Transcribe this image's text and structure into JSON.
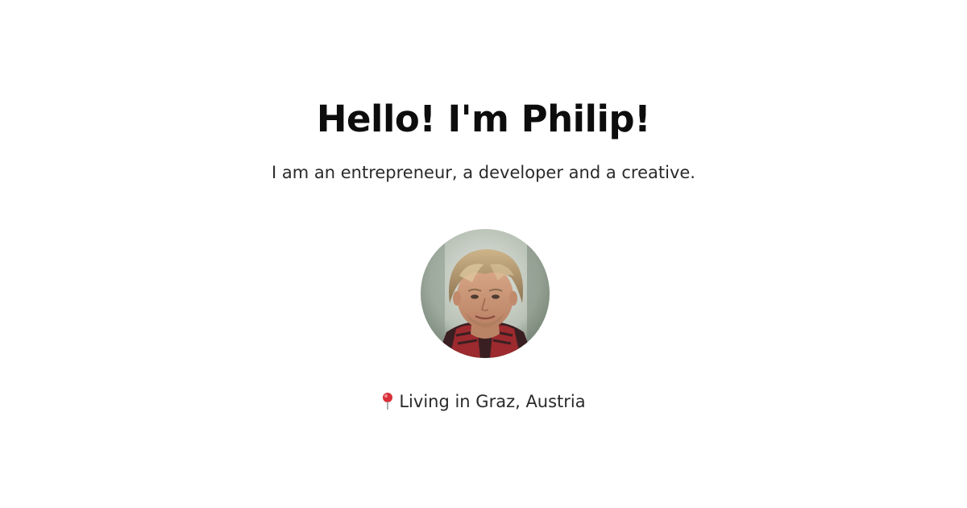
{
  "hero": {
    "headline": "Hello! I'm Philip!",
    "tagline": "I am an entrepreneur, a developer and a creative."
  },
  "profile": {
    "avatar_icon": "person-portrait",
    "location_icon": "pin-icon",
    "location_text": "Living in Graz, Austria"
  },
  "colors": {
    "background": "#ffffff",
    "headline": "#0d0d0d",
    "body_text": "#2a2a2a",
    "pin": "#d8303a"
  }
}
